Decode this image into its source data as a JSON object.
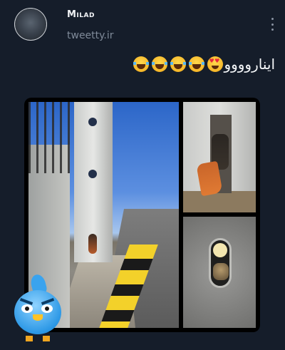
{
  "header": {
    "username": "Milad",
    "handle": "tweetty.ir"
  },
  "tweet": {
    "text": "ایناروووو",
    "emojis": [
      "laughing-with-tears",
      "laughing-with-tears",
      "laughing-with-tears",
      "laughing-with-tears",
      "heart-eyes"
    ]
  },
  "media": {
    "photo_count": 3
  },
  "icons": {
    "more": "more-vertical-icon",
    "mascot": "angry-blue-bird-mascot"
  }
}
